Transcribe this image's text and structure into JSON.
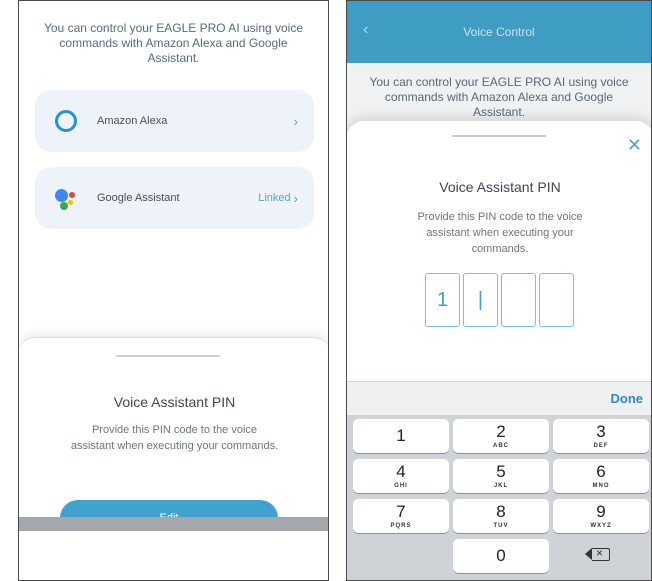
{
  "left": {
    "intro": "You can control your EAGLE PRO AI using voice commands with Amazon Alexa and Google Assistant.",
    "assistants": [
      {
        "name": "Amazon Alexa",
        "status": "",
        "chevron": "›",
        "icon": "alexa-icon"
      },
      {
        "name": "Google Assistant",
        "status": "Linked",
        "chevron": "›",
        "icon": "google-assistant-icon"
      }
    ],
    "sheet": {
      "title": "Voice Assistant PIN",
      "description": "Provide this PIN code to the voice assistant when executing your commands.",
      "edit_label": "Edit"
    }
  },
  "right": {
    "nav": {
      "back": "‹",
      "title": "Voice Control"
    },
    "intro": "You can control your EAGLE PRO AI using voice commands with Amazon Alexa and Google Assistant.",
    "sheet": {
      "close": "✕",
      "title": "Voice Assistant PIN",
      "description": "Provide this PIN code to the voice assistant when executing your commands.",
      "pin": [
        "1",
        "|",
        "",
        ""
      ]
    },
    "keyboard": {
      "done_label": "Done",
      "keys": [
        {
          "num": "1",
          "letters": ""
        },
        {
          "num": "2",
          "letters": "ABC"
        },
        {
          "num": "3",
          "letters": "DEF"
        },
        {
          "num": "4",
          "letters": "GHI"
        },
        {
          "num": "5",
          "letters": "JKL"
        },
        {
          "num": "6",
          "letters": "MNO"
        },
        {
          "num": "7",
          "letters": "PQRS"
        },
        {
          "num": "8",
          "letters": "TUV"
        },
        {
          "num": "9",
          "letters": "WXYZ"
        },
        {
          "num": "0",
          "letters": ""
        }
      ]
    }
  },
  "colors": {
    "accent": "#3fa3cd",
    "link": "#4fa6d3",
    "card": "#eef3f9"
  }
}
